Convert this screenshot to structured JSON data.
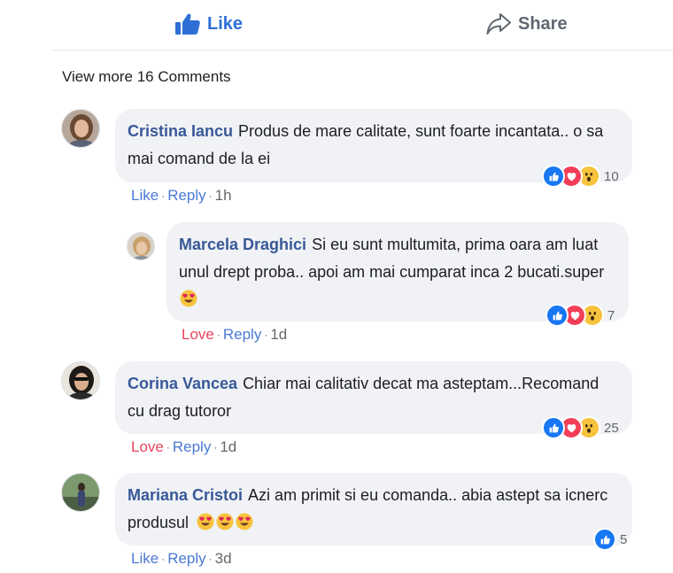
{
  "actions": {
    "like_label": "Like",
    "share_label": "Share"
  },
  "view_more": "View more 16 Comments",
  "comments": [
    {
      "author": "Cristina Iancu",
      "text": "Produs de mare calitate, sunt foarte incantata.. o sa mai comand de la ei",
      "reaction_count": "10",
      "reactions": [
        "like-icon",
        "love-icon",
        "wow-icon"
      ],
      "action": "Like",
      "reply": "Reply",
      "time": "1h"
    },
    {
      "author": "Marcela Draghici",
      "text": "Si eu sunt multumita, prima oara am luat unul drept proba.. apoi am mai cumparat inca 2 bucati.super",
      "reaction_count": "7",
      "reactions": [
        "like-icon",
        "love-icon",
        "wow-icon"
      ],
      "action": "Love",
      "reply": "Reply",
      "time": "1d"
    },
    {
      "author": "Corina Vancea",
      "text": "Chiar mai calitativ decat ma asteptam...Recomand cu drag tutoror",
      "reaction_count": "25",
      "reactions": [
        "like-icon",
        "love-icon",
        "wow-icon"
      ],
      "action": "Love",
      "reply": "Reply",
      "time": "1d"
    },
    {
      "author": "Mariana Cristoi",
      "text": "Azi am primit si eu comanda.. abia astept sa icnerc produsul",
      "reaction_count": "5",
      "reactions": [
        "like-icon"
      ],
      "action": "Like",
      "reply": "Reply",
      "time": "3d"
    }
  ],
  "colors": {
    "link_blue": "#385898",
    "like_blue": "#1877f2",
    "love_red": "#f33e58",
    "wow_yellow": "#f7c33c",
    "bubble_bg": "#f0f2f5"
  }
}
